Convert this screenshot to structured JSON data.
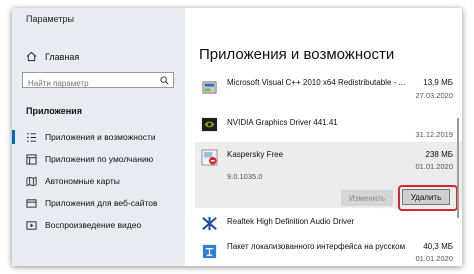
{
  "window": {
    "title": "Параметры"
  },
  "sidebar": {
    "home_label": "Главная",
    "search_placeholder": "Найти параметр",
    "section_title": "Приложения",
    "items": [
      {
        "label": "Приложения и возможности",
        "icon": "list-icon",
        "active": true
      },
      {
        "label": "Приложения по умолчанию",
        "icon": "default-apps-icon",
        "active": false
      },
      {
        "label": "Автономные карты",
        "icon": "map-icon",
        "active": false
      },
      {
        "label": "Приложения для веб-сайтов",
        "icon": "web-icon",
        "active": false
      },
      {
        "label": "Воспроизведение видео",
        "icon": "video-icon",
        "active": false
      }
    ]
  },
  "main": {
    "title": "Приложения и возможности",
    "apps": [
      {
        "name": "Microsoft Visual C++ 2010  x64 Redistributable - ...",
        "size": "13,9 МБ",
        "date": "27.03.2020",
        "icon": "installer-icon"
      },
      {
        "name": "NVIDIA Graphics Driver 441.41",
        "size": "",
        "date": "31.12.2019",
        "icon": "nvidia-icon"
      },
      {
        "name": "Kaspersky Free",
        "size": "238 МБ",
        "date": "01.01.2020",
        "version": "9.0.1035.0",
        "icon": "kaspersky-icon",
        "selected": true
      },
      {
        "name": "Realtek High Definition Audio Driver",
        "size": "",
        "date": "",
        "icon": "realtek-icon"
      },
      {
        "name": "Пакет локализованного интерфейса на русском",
        "size": "40,3 МБ",
        "date": "01.01.2020",
        "icon": "language-pack-icon"
      }
    ],
    "modify_label": "Изменить",
    "uninstall_label": "Удалить"
  },
  "colors": {
    "accent": "#0067c0",
    "highlight": "#d7262f",
    "sidebar_bg": "#e6ecf2"
  }
}
